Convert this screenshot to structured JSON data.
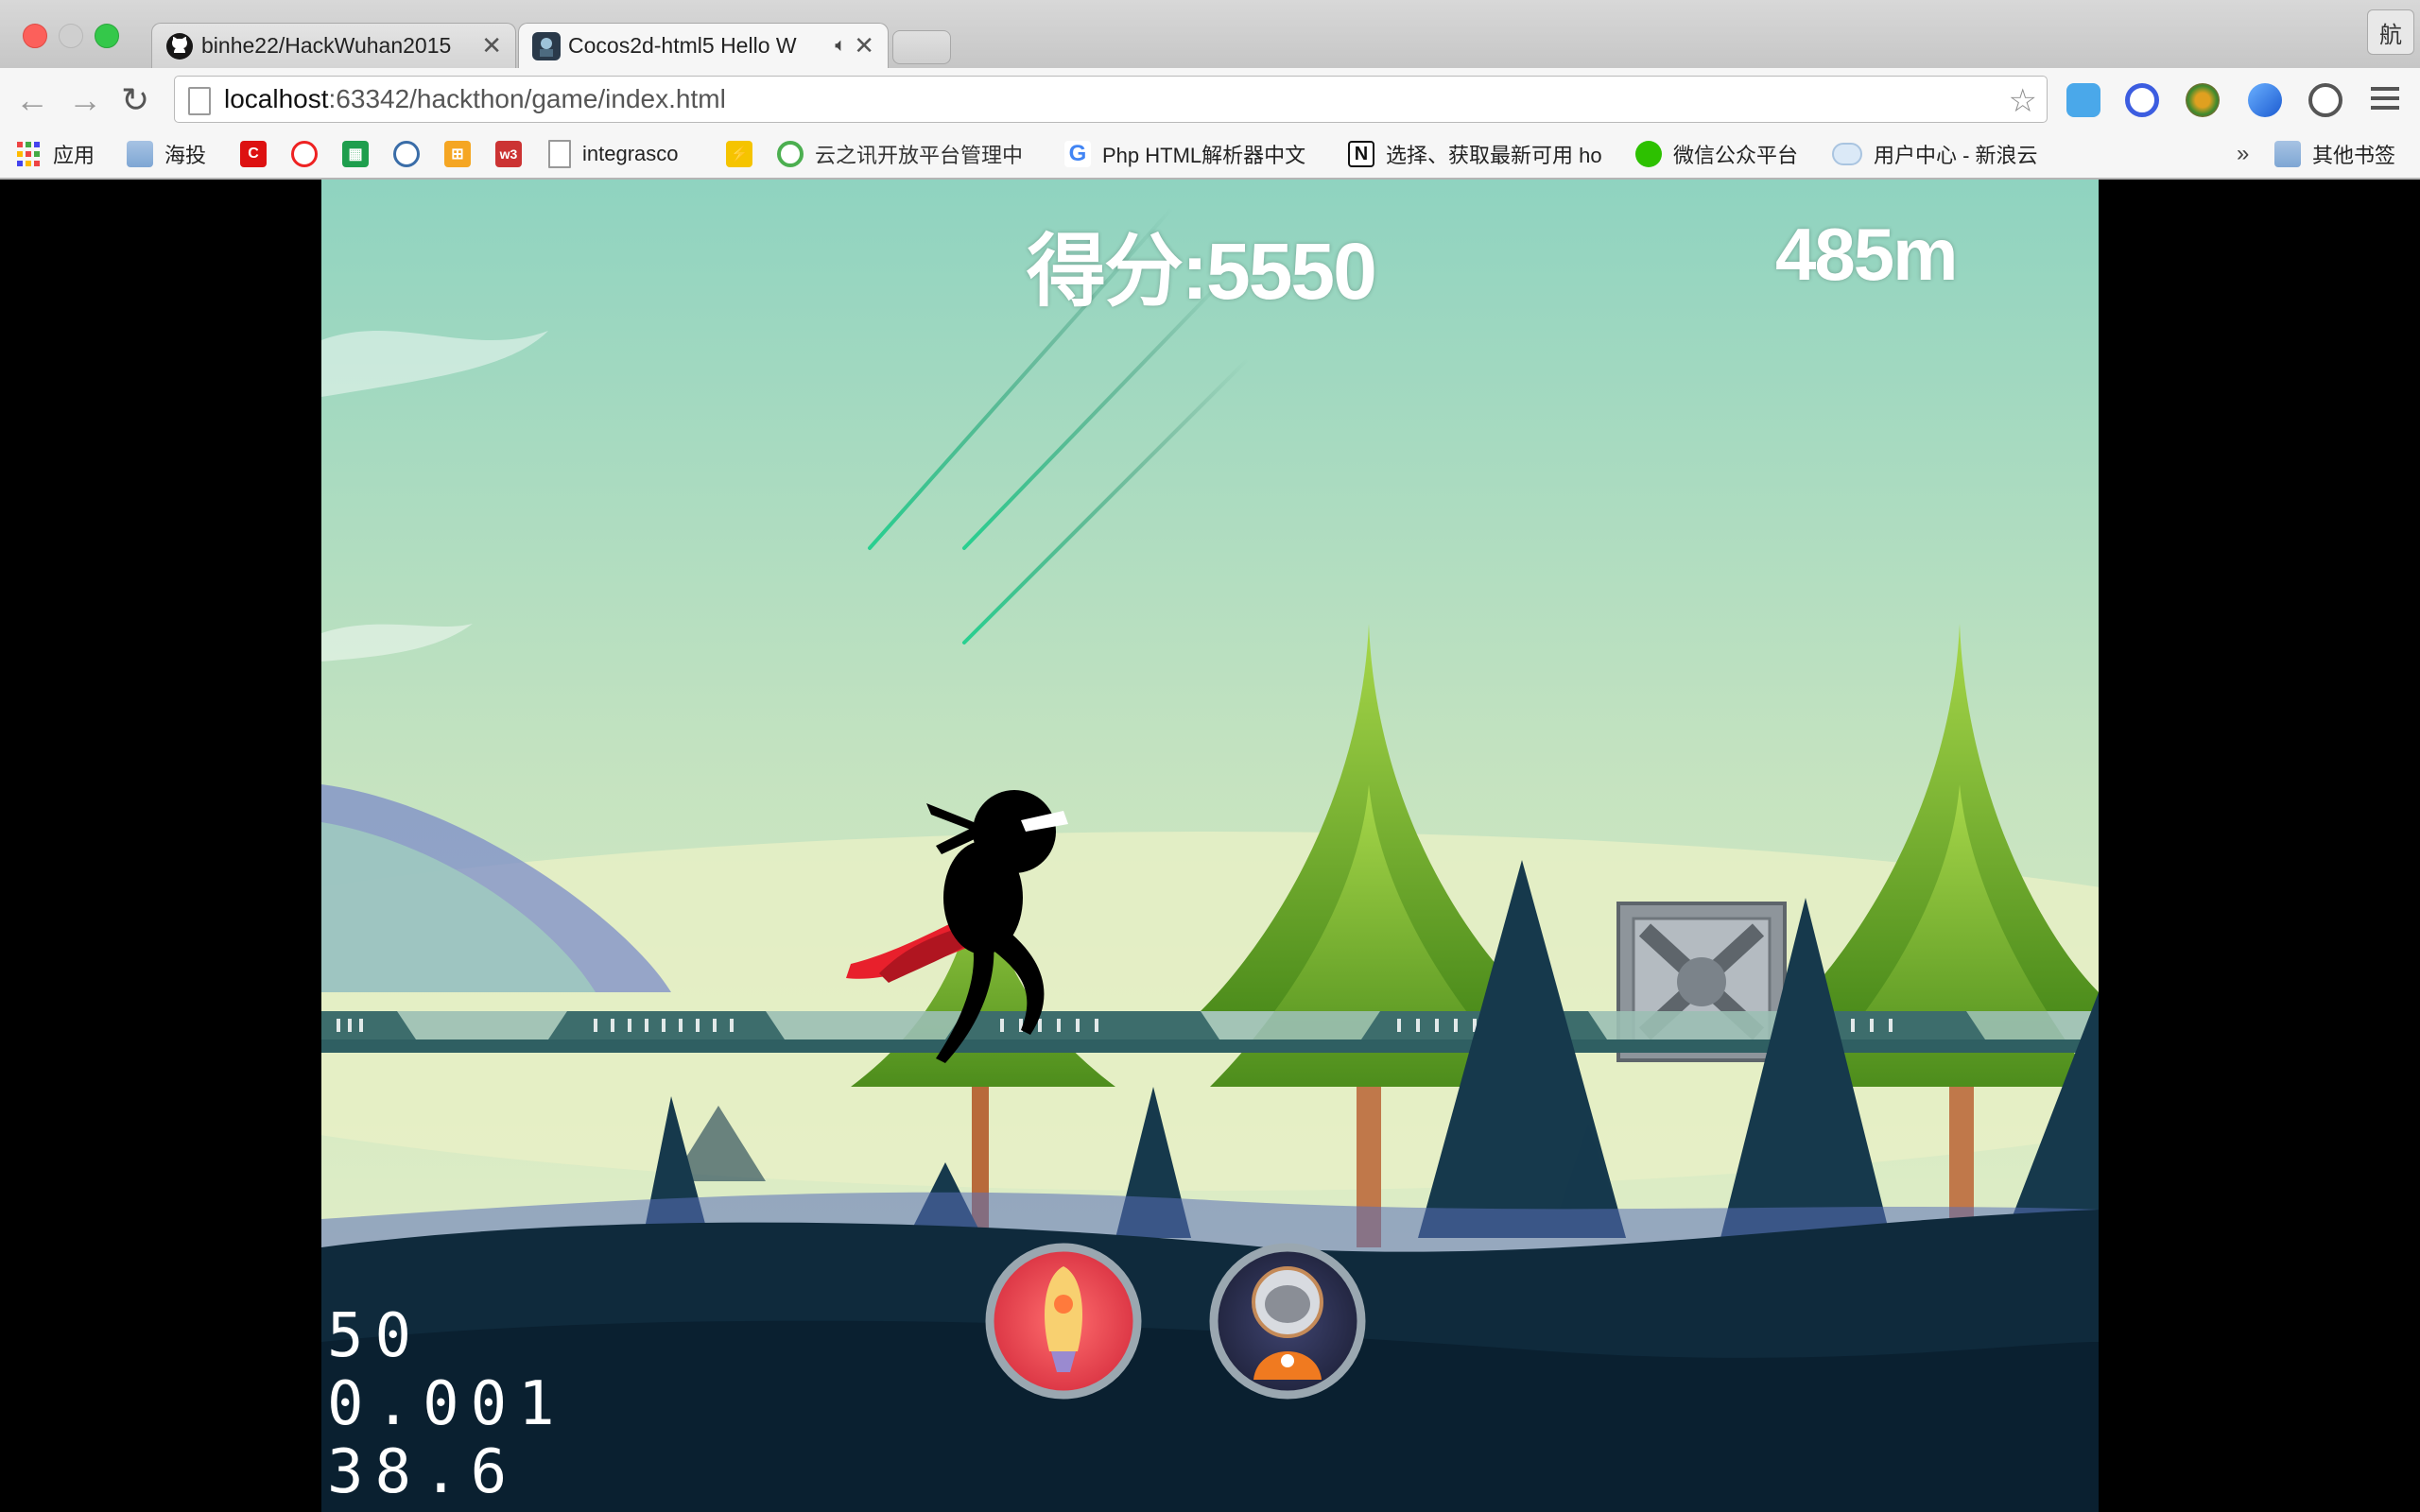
{
  "browser": {
    "tabs": [
      {
        "title": "binhe22/HackWuhan2015",
        "favicon": "github-icon",
        "active": false
      },
      {
        "title": "Cocos2d-html5 Hello W",
        "favicon": "cocos-icon",
        "active": true,
        "audio": true
      }
    ],
    "corner_label": "航",
    "url": {
      "host": "localhost",
      "path": ":63342/hackthon/game/index.html"
    },
    "bookmarks": [
      {
        "label": "应用",
        "icon": "apps-grid-icon"
      },
      {
        "label": "海投",
        "icon": "folder-icon"
      },
      {
        "label": "",
        "icon": "csdn-icon"
      },
      {
        "label": "",
        "icon": "weibo-icon"
      },
      {
        "label": "",
        "icon": "sheets-icon"
      },
      {
        "label": "",
        "icon": "hex-icon"
      },
      {
        "label": "",
        "icon": "orange-grid-icon"
      },
      {
        "label": "",
        "icon": "w3-icon"
      },
      {
        "label": "integrasco",
        "icon": "page-icon"
      },
      {
        "label": "",
        "icon": "flash-icon"
      },
      {
        "label": "云之讯开放平台管理中",
        "icon": "yunzhixun-icon"
      },
      {
        "label": "Php HTML解析器中文",
        "icon": "google-icon"
      },
      {
        "label": "选择、获取最新可用 ho",
        "icon": "n-icon"
      },
      {
        "label": "微信公众平台",
        "icon": "wechat-icon"
      },
      {
        "label": "用户中心 - 新浪云",
        "icon": "cloud-icon"
      }
    ],
    "overflow_chevron": "»",
    "other_bookmarks": "其他书签"
  },
  "game": {
    "score_label": "得分:5550",
    "distance_label": "485m",
    "stats": [
      "50",
      "0.001",
      "38.6"
    ],
    "powerups": [
      {
        "name": "rocket-powerup",
        "color": "#e8454d"
      },
      {
        "name": "astronaut-powerup",
        "color": "#2b2f4d"
      }
    ],
    "colors": {
      "sky_top": "#8fd3c0",
      "sky_bottom": "#e6f0c4",
      "ground": "#0f2a3c",
      "rail": "#3d6d6c",
      "tree": "#6fae2a"
    }
  }
}
